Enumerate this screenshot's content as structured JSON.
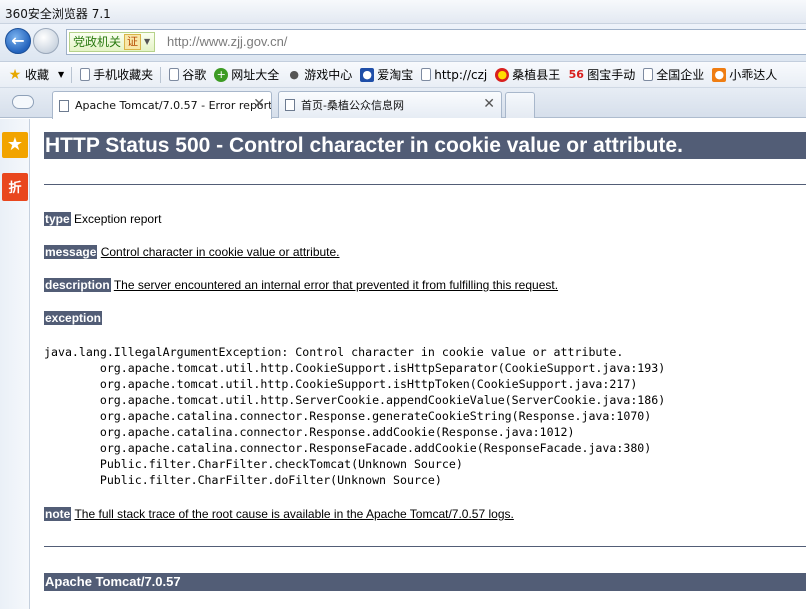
{
  "window": {
    "title": "360安全浏览器 7.1"
  },
  "address_bar": {
    "zone_label": "党政机关",
    "cert_label": "证",
    "url": "http://www.zjj.gov.cn/"
  },
  "bookmarks": [
    {
      "label": "收藏",
      "icon": "star-icon"
    },
    {
      "label": "手机收藏夹",
      "icon": "page-icon"
    },
    {
      "label": "谷歌",
      "icon": "page-icon"
    },
    {
      "label": "网址大全",
      "icon": "green-plus-icon"
    },
    {
      "label": "游戏中心",
      "icon": "gamepad-icon"
    },
    {
      "label": "爱淘宝",
      "icon": "paw-icon"
    },
    {
      "label": "http://czj",
      "icon": "page-icon"
    },
    {
      "label": "桑植县王",
      "icon": "red-circle-icon"
    },
    {
      "label": "图宝手动",
      "icon": "56-icon"
    },
    {
      "label": "全国企业",
      "icon": "page-icon"
    },
    {
      "label": "小乖达人",
      "icon": "tao-icon"
    }
  ],
  "tabs": [
    {
      "label": "Apache Tomcat/7.0.57 - Error report",
      "active": true
    },
    {
      "label": "首页-桑植公众信息网",
      "active": false
    }
  ],
  "sidebar": {
    "star_glyph": "★",
    "zhe_glyph": "折"
  },
  "error_page": {
    "heading": "HTTP Status 500 - Control character in cookie value or attribute.",
    "type_label": "type",
    "type_value": "Exception report",
    "message_label": "message",
    "message_value": "Control character in cookie value or attribute.",
    "description_label": "description",
    "description_value": "The server encountered an internal error that prevented it from fulfilling this request.",
    "exception_label": "exception",
    "stack_trace": "java.lang.IllegalArgumentException: Control character in cookie value or attribute.\n\torg.apache.tomcat.util.http.CookieSupport.isHttpSeparator(CookieSupport.java:193)\n\torg.apache.tomcat.util.http.CookieSupport.isHttpToken(CookieSupport.java:217)\n\torg.apache.tomcat.util.http.ServerCookie.appendCookieValue(ServerCookie.java:186)\n\torg.apache.catalina.connector.Response.generateCookieString(Response.java:1070)\n\torg.apache.catalina.connector.Response.addCookie(Response.java:1012)\n\torg.apache.catalina.connector.ResponseFacade.addCookie(ResponseFacade.java:380)\n\tPublic.filter.CharFilter.checkTomcat(Unknown Source)\n\tPublic.filter.CharFilter.doFilter(Unknown Source)",
    "note_label": "note",
    "note_value": "The full stack trace of the root cause is available in the Apache Tomcat/7.0.57 logs.",
    "footer": "Apache Tomcat/7.0.57"
  },
  "colors": {
    "tomcat_header": "#525d76",
    "zone_text": "#2a7a11"
  }
}
